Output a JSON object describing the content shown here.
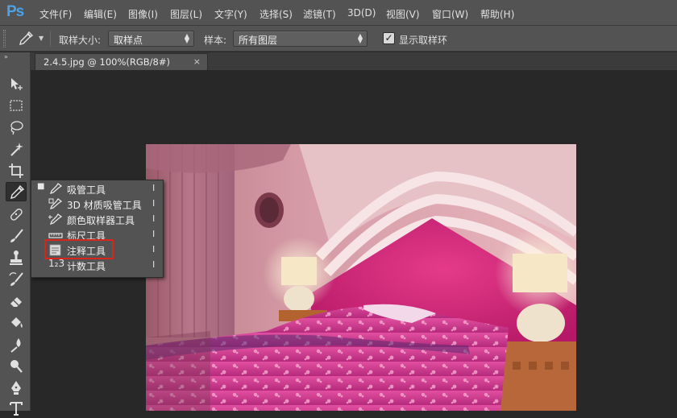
{
  "app": {
    "logo": "Ps"
  },
  "menu": [
    {
      "label": "文件(F)"
    },
    {
      "label": "编辑(E)"
    },
    {
      "label": "图像(I)"
    },
    {
      "label": "图层(L)"
    },
    {
      "label": "文字(Y)"
    },
    {
      "label": "选择(S)"
    },
    {
      "label": "滤镜(T)"
    },
    {
      "label": "3D(D)"
    },
    {
      "label": "视图(V)"
    },
    {
      "label": "窗口(W)"
    },
    {
      "label": "帮助(H)"
    }
  ],
  "options": {
    "sample_size_label": "取样大小:",
    "sample_size_value": "取样点",
    "sample_label": "样本:",
    "sample_value": "所有图层",
    "show_ring_label": "显示取样环",
    "show_ring_checked": true
  },
  "document": {
    "tab_title": "2.4.5.jpg @ 100%(RGB/8#)",
    "close_glyph": "×"
  },
  "toolbox": {
    "collapse_glyph": "»",
    "tools": [
      {
        "name": "move-tool",
        "icon": "move-icon"
      },
      {
        "name": "marquee-tool",
        "icon": "marquee-icon"
      },
      {
        "name": "lasso-tool",
        "icon": "lasso-icon"
      },
      {
        "name": "magic-wand-tool",
        "icon": "magic-wand-icon"
      },
      {
        "name": "crop-tool",
        "icon": "crop-icon"
      },
      {
        "name": "eyedropper-tool",
        "icon": "eyedropper-icon",
        "active": true
      },
      {
        "name": "healing-brush-tool",
        "icon": "bandage-icon"
      },
      {
        "name": "brush-tool",
        "icon": "brush-icon"
      },
      {
        "name": "clone-stamp-tool",
        "icon": "stamp-icon"
      },
      {
        "name": "history-brush-tool",
        "icon": "history-brush-icon"
      },
      {
        "name": "eraser-tool",
        "icon": "eraser-icon"
      },
      {
        "name": "paint-bucket-tool",
        "icon": "bucket-icon"
      },
      {
        "name": "blur-tool",
        "icon": "blur-icon"
      },
      {
        "name": "dodge-tool",
        "icon": "dodge-icon"
      },
      {
        "name": "pen-tool",
        "icon": "pen-icon"
      },
      {
        "name": "type-tool",
        "icon": "type-icon"
      }
    ]
  },
  "flyout": {
    "items": [
      {
        "label": "吸管工具",
        "shortcut": "I",
        "icon": "eyedropper-icon",
        "selected": true
      },
      {
        "label": "3D 材质吸管工具",
        "shortcut": "I",
        "icon": "3d-eyedropper-icon"
      },
      {
        "label": "颜色取样器工具",
        "shortcut": "I",
        "icon": "color-sampler-icon"
      },
      {
        "label": "标尺工具",
        "shortcut": "I",
        "icon": "ruler-icon"
      },
      {
        "label": "注释工具",
        "shortcut": "I",
        "icon": "note-icon",
        "highlighted": true
      },
      {
        "label": "计数工具",
        "shortcut": "I",
        "icon": "count-icon"
      }
    ],
    "bullet": "■",
    "count_icon_text": "1₂3"
  },
  "colors": {
    "ui_bg": "#535353",
    "canvas_bg": "#282828",
    "logo": "#4aa2e8",
    "highlight_border": "#d9261c"
  }
}
